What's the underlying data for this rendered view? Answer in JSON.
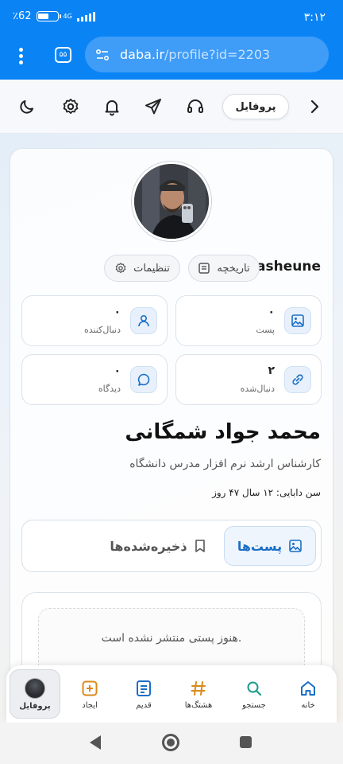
{
  "status_bar": {
    "time": "۳:۱۲",
    "battery": "٪62",
    "battery_level": 0.62,
    "network": "4G"
  },
  "browser": {
    "tab_count": "۵۵",
    "url_domain": "daba.ir",
    "url_path": "/profile?id=2203"
  },
  "header": {
    "page_pill": "پروفایل",
    "icons": [
      "back-arrow-icon",
      "headset-icon",
      "send-icon",
      "bell-icon",
      "gear-icon",
      "moon-icon"
    ]
  },
  "profile": {
    "username": "asheune",
    "history_label": "تاریخچه",
    "settings_label": "تنظیمات",
    "full_name": "محمد جواد شمگانی",
    "bio": "کارشناس ارشد نرم افزار مدرس دانشگاه",
    "age": "سن دابایی: ۱۲ سال ۴۷ روز"
  },
  "stats": [
    {
      "value": "۰",
      "label": "پست",
      "icon": "image-icon"
    },
    {
      "value": "۰",
      "label": "دنبال‌کننده",
      "icon": "user-icon"
    },
    {
      "value": "۲",
      "label": "دنبال‌شده",
      "icon": "link-icon"
    },
    {
      "value": "۰",
      "label": "دیدگاه",
      "icon": "comment-icon"
    }
  ],
  "tabs": {
    "posts": "پست‌ها",
    "saved": "ذخیره‌شده‌ها"
  },
  "empty_state": "هنوز پستی منتشر نشده است.",
  "bottom_nav": [
    {
      "label": "خانه",
      "icon": "home-icon"
    },
    {
      "label": "جستجو",
      "icon": "search-icon"
    },
    {
      "label": "هشتگ‌ها",
      "icon": "hashtag-icon"
    },
    {
      "label": "قدیم",
      "icon": "list-icon"
    },
    {
      "label": "ایجاد",
      "icon": "plus-icon"
    },
    {
      "label": "پروفایل",
      "icon": "avatar"
    }
  ],
  "colors": {
    "browser_blue": "#0a84f5",
    "accent_blue": "#1b6fc7",
    "hashtag_orange": "#d98a1c"
  }
}
